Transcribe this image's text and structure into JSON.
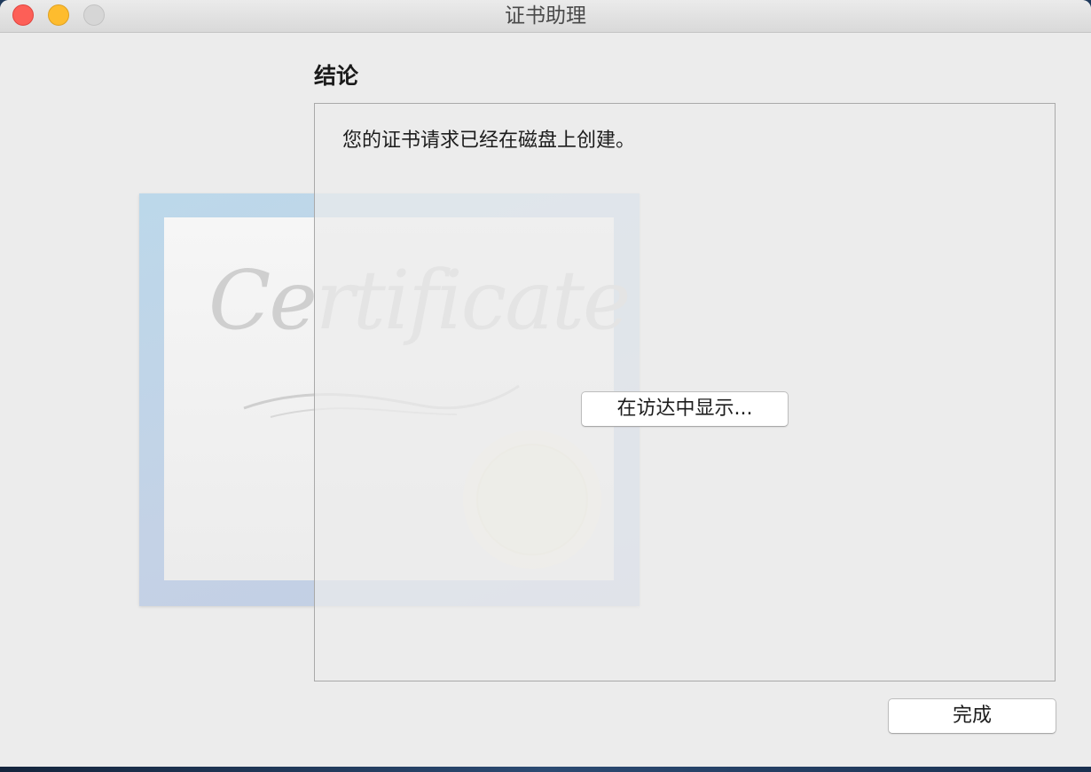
{
  "window": {
    "title": "证书助理"
  },
  "main": {
    "section_title": "结论",
    "message": "您的证书请求已经在磁盘上创建。",
    "show_in_finder_label": "在访达中显示...",
    "done_label": "完成"
  },
  "artwork": {
    "certificate_word": "Certificate"
  },
  "colors": {
    "close": "#fd5f57",
    "minimize": "#febc2e",
    "zoom_disabled": "#d6d6d6",
    "window_bg": "#ececec"
  },
  "icons": {
    "close": "close-button",
    "minimize": "minimize-button",
    "zoom": "zoom-button"
  }
}
